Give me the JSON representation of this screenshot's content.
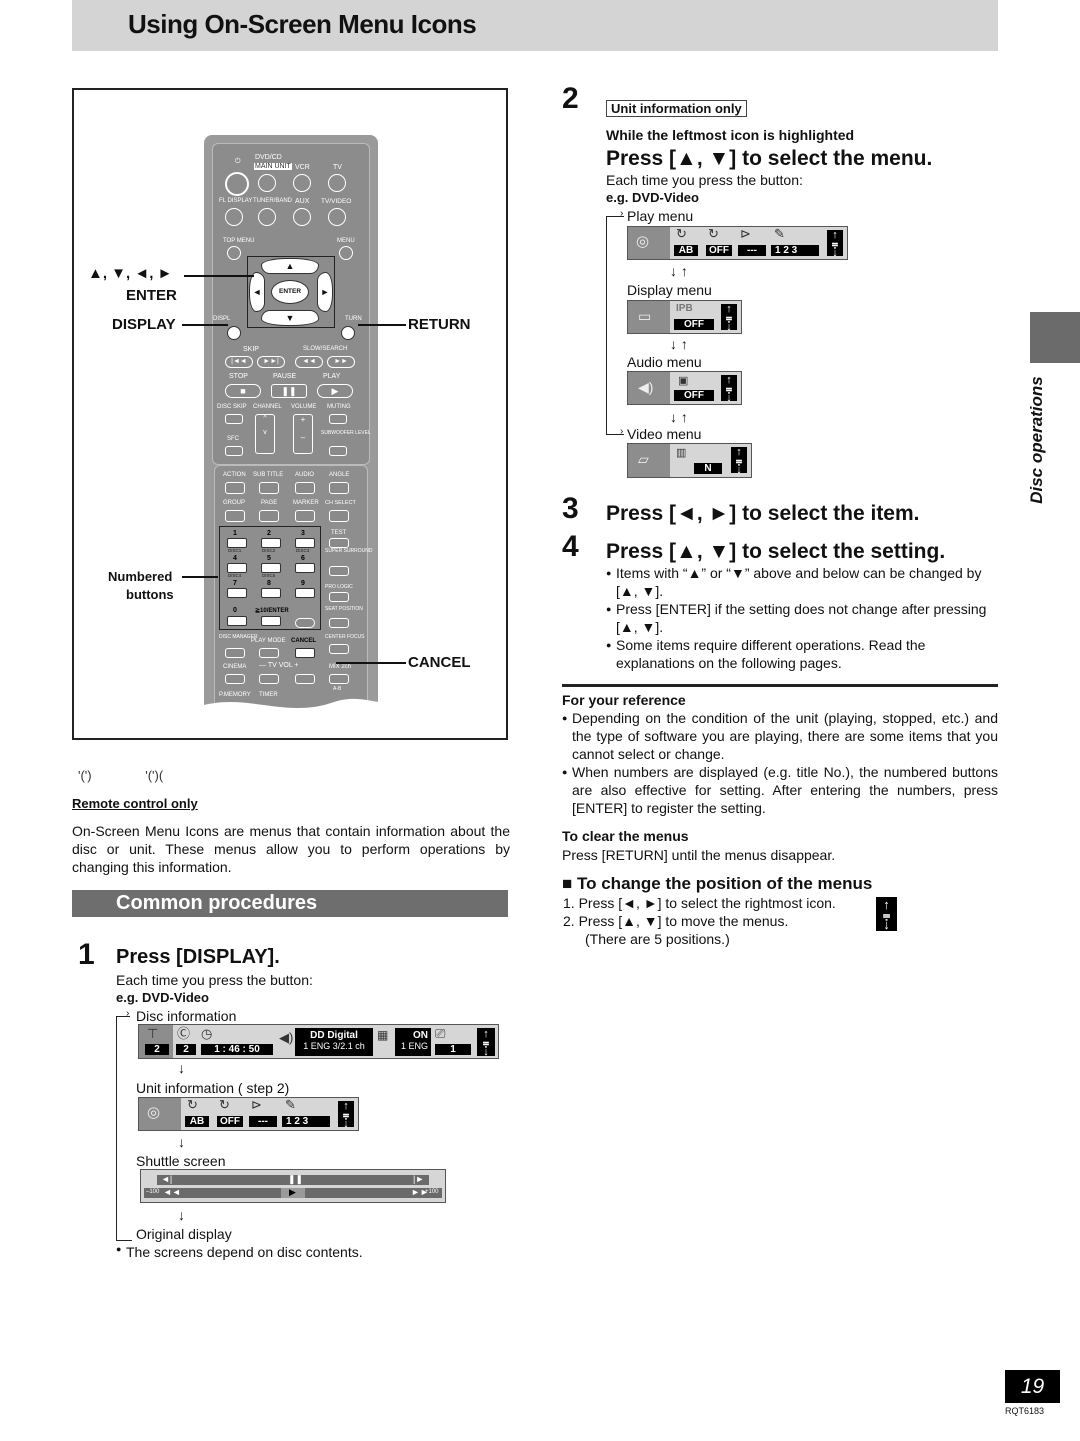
{
  "header": {
    "title": "Using On-Screen Menu Icons"
  },
  "remote": {
    "labels": {
      "power": "⏻",
      "dvdcd": "DVD/CD",
      "main_unit": "MAIN UNIT",
      "vcr": "VCR",
      "tv": "TV",
      "fl_display": "FL DISPLAY",
      "tuner_band": "TUNER/BAND",
      "aux": "AUX",
      "tv_video": "TV/VIDEO",
      "top_menu": "TOP MENU",
      "menu": "MENU",
      "enter": "ENTER",
      "display": "DISPLAY",
      "return": "RETURN",
      "skip": "SKIP",
      "slow_search": "SLOW/SEARCH",
      "stop": "STOP",
      "pause": "PAUSE",
      "play": "PLAY",
      "disc_skip": "DISC SKIP",
      "channel": "CHANNEL",
      "volume": "VOLUME",
      "muting": "MUTING",
      "sfc": "SFC",
      "subwoofer_level": "SUBWOOFER LEVEL",
      "action": "ACTION",
      "sub_title": "SUB TITLE",
      "audio": "AUDIO",
      "angle": "ANGLE",
      "group": "GROUP",
      "page": "PAGE",
      "marker": "MARKER",
      "ch_select": "CH SELECT",
      "test": "TEST",
      "super_surround": "SUPER SURROUND",
      "pro_logic": "PRO LOGIC",
      "seat_position": "SEAT POSITION",
      "center_focus": "CENTER FOCUS",
      "disc_manager": "DISC MANAGER",
      "play_mode": "PLAY MODE",
      "cancel": "CANCEL",
      "cinema": "CINEMA",
      "tv_vol": "— TV VOL +",
      "mix_2ch": "MIX 2ch",
      "ab": "A-B",
      "pmemory": "P.MEMORY",
      "timer": "TIMER",
      "ten_enter": "≧10/ENTER"
    },
    "numbers": [
      "1",
      "2",
      "3",
      "4",
      "5",
      "6",
      "7",
      "8",
      "9",
      "0"
    ],
    "disc_labels": [
      "DISC1",
      "DISC2",
      "DISC3",
      "DISC4",
      "DISC5"
    ],
    "callouts": {
      "arrows": "▲, ▼, ◄, ►",
      "enter": "ENTER",
      "display": "DISPLAY",
      "return": "RETURN",
      "numbered": "Numbered",
      "buttons": "buttons",
      "cancel": "CANCEL"
    }
  },
  "left": {
    "glyphs": "'(') '(')(",
    "remote_only": "Remote control only",
    "intro": "On-Screen Menu Icons are menus that contain information about the disc or unit. These menus allow you to perform operations by changing this information.",
    "section_title": "Common procedures",
    "step1": {
      "num": "1",
      "heading": "Press [DISPLAY].",
      "each_time": "Each time you press the button:",
      "eg": "e.g. DVD-Video",
      "disc_info": "Disc information",
      "disc_osd": {
        "title": "2",
        "chapter": "2",
        "time": "1 : 46 : 50",
        "audio_top": "DD Digital",
        "audio_bottom": "1 ENG  3/2.1 ch",
        "sub_top": "ON",
        "sub_bottom": "1  ENG",
        "angle": "1"
      },
      "unit_info": "Unit information (    step 2)",
      "unit_osd": {
        "repeat_ab": "AB",
        "repeat": "OFF",
        "random": "---",
        "program": "1 2 3"
      },
      "shuttle": "Shuttle screen",
      "shuttle_osd": {
        "minus": "–100",
        "plus": "+100"
      },
      "original": "Original display",
      "note": "The screens depend on disc contents."
    }
  },
  "right": {
    "step2": {
      "num": "2",
      "badge": "Unit information only",
      "while": "While the leftmost icon is highlighted",
      "heading": "Press [▲, ▼] to select the menu.",
      "each_time": "Each time you press the button:",
      "eg": "e.g. DVD-Video",
      "menus": [
        {
          "name": "Play menu",
          "values": [
            "AB",
            "OFF",
            "---",
            "1 2 3"
          ]
        },
        {
          "name": "Display menu",
          "label": "IPB",
          "values": [
            "OFF"
          ]
        },
        {
          "name": "Audio menu",
          "values": [
            "OFF"
          ]
        },
        {
          "name": "Video menu",
          "values": [
            "N"
          ]
        }
      ],
      "updown": "↓ ↑"
    },
    "step3": {
      "num": "3",
      "heading": "Press [◄, ►] to select the item."
    },
    "step4": {
      "num": "4",
      "heading": "Press [▲, ▼] to select the setting.",
      "bullets": [
        "Items with “▲” or “▼” above and below can be changed by [▲, ▼].",
        "Press [ENTER] if the setting does not change after pressing [▲, ▼].",
        "Some items require different operations. Read the explanations on the following pages."
      ]
    },
    "reference": {
      "title": "For your reference",
      "bullets": [
        "Depending on the condition of the unit (playing, stopped, etc.) and the type of software you are playing, there are some items that you cannot select or change.",
        "When numbers are displayed (e.g. title No.), the numbered buttons are also effective for setting. After entering the numbers, press [ENTER] to register the setting."
      ]
    },
    "clear": {
      "title": "To clear the menus",
      "text": "Press [RETURN] until the menus disappear."
    },
    "position": {
      "title": "To change the position of the menus",
      "steps": [
        "1.  Press [◄, ►] to select the rightmost icon.",
        "2.  Press [▲, ▼] to move the menus.",
        "(There are 5 positions.)"
      ]
    }
  },
  "sidebar": {
    "label": "Disc operations"
  },
  "footer": {
    "page": "19",
    "code": "RQT6183"
  }
}
